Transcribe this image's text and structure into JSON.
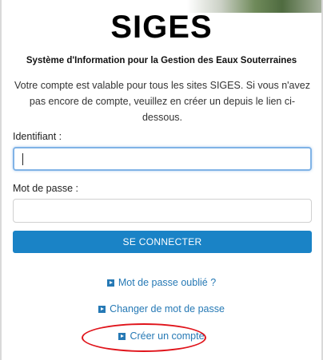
{
  "header": {
    "logo_text": "SIGES",
    "subtitle": "Système d'Information pour la Gestion des Eaux Souterraines",
    "intro": "Votre compte est valable pour tous les sites SIGES. Si vous n'avez pas encore de compte, veuillez en créer un depuis le lien ci-dessous."
  },
  "form": {
    "username_label": "Identifiant :",
    "username_value": "",
    "password_label": "Mot de passe :",
    "password_value": "",
    "submit_label": "SE CONNECTER"
  },
  "links": {
    "forgot": "Mot de passe oublié ?",
    "change": "Changer de mot de passe",
    "create": "Créer un compte"
  },
  "colors": {
    "primary_button": "#1a83c6",
    "link": "#2679b5",
    "focus_border": "#80b3e6",
    "annotation": "#e0141b"
  },
  "icons": {
    "link_bullet": "caret-right-square-icon"
  }
}
